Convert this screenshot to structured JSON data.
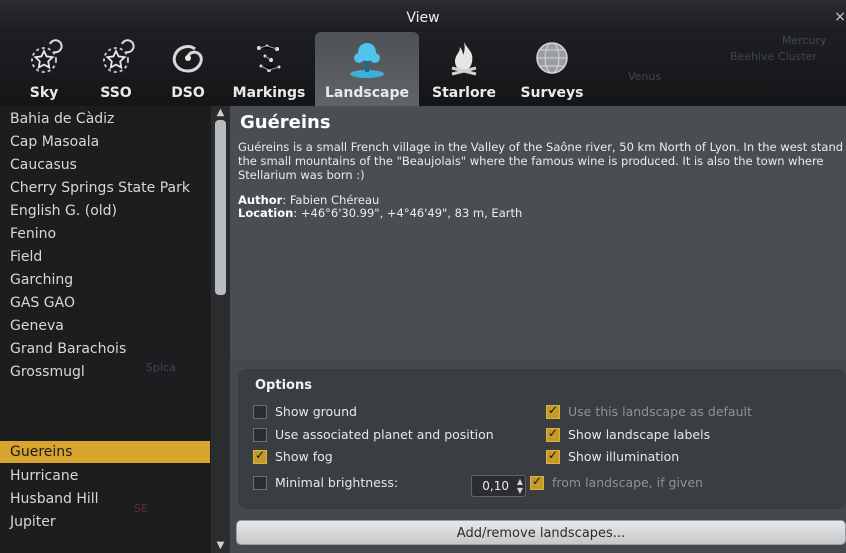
{
  "window": {
    "title": "View",
    "close_glyph": "×"
  },
  "tabs": [
    {
      "label": "Sky",
      "icon": "sky-icon"
    },
    {
      "label": "SSO",
      "icon": "sso-icon"
    },
    {
      "label": "DSO",
      "icon": "dso-galaxy-icon"
    },
    {
      "label": "Markings",
      "icon": "markings-icon"
    },
    {
      "label": "Landscape",
      "icon": "landscape-tree-icon",
      "active": true
    },
    {
      "label": "Starlore",
      "icon": "starlore-fire-icon"
    },
    {
      "label": "Surveys",
      "icon": "surveys-globe-icon"
    }
  ],
  "landscapes": [
    "Bahia de Càdiz",
    "Cap Masoala",
    "Caucasus",
    "Cherry Springs State Park",
    "English G. (old)",
    "Fenino",
    "Field",
    "Garching",
    "GAS GAO",
    "Geneva",
    "Grand Barachois",
    "Grossmugl",
    "Guereins",
    "Hurricane",
    "Husband Hill",
    "Jupiter"
  ],
  "selected_landscape": "Guereins",
  "info": {
    "title": "Guéreins",
    "description": "Guéreins is a small French village in the Valley of the Saône river, 50 km North of Lyon. In the west stand the small mountains of the \"Beaujolais\" where the famous wine is produced. It is also the town where Stellarium was born :)",
    "author_label": "Author",
    "author": ": Fabien Chéreau",
    "location_label": "Location",
    "location": ": +46°6'30.99\", +4°46'49\", 83 m, Earth"
  },
  "options": {
    "title": "Options",
    "show_ground": {
      "label": "Show ground",
      "checked": false
    },
    "use_planet": {
      "label": "Use associated planet and position",
      "checked": false
    },
    "show_fog": {
      "label": "Show fog",
      "checked": true
    },
    "minimal_brightness": {
      "label": "Minimal brightness:",
      "checked": false,
      "value": "0,10"
    },
    "use_default": {
      "label": "Use this landscape as default",
      "checked": true
    },
    "show_labels": {
      "label": "Show landscape labels",
      "checked": true
    },
    "show_illumination": {
      "label": "Show illumination",
      "checked": true
    },
    "from_landscape": {
      "label": "from landscape, if given",
      "checked": true
    }
  },
  "add_remove_button": "Add/remove landscapes...",
  "background_sky_labels": [
    "Spica",
    "SE",
    "Venus",
    "Mercury",
    "Beehive Cluster"
  ],
  "colors": {
    "accent": "#d7a52e",
    "panel": "#4a4e52",
    "checkbox": "#c49a2c"
  }
}
